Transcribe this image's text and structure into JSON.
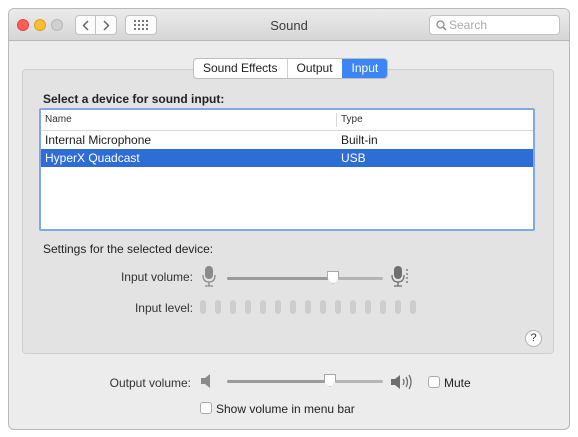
{
  "window": {
    "title": "Sound"
  },
  "search": {
    "placeholder": "Search"
  },
  "tabs": [
    {
      "label": "Sound Effects",
      "active": false
    },
    {
      "label": "Output",
      "active": false
    },
    {
      "label": "Input",
      "active": true
    }
  ],
  "input_section": {
    "heading": "Select a device for sound input:",
    "columns": {
      "name": "Name",
      "type": "Type"
    },
    "devices": [
      {
        "name": "Internal Microphone",
        "type": "Built-in",
        "selected": false
      },
      {
        "name": "HyperX Quadcast",
        "type": "USB",
        "selected": true
      }
    ]
  },
  "settings": {
    "label": "Settings for the selected device:",
    "input_volume_label": "Input volume:",
    "input_volume_value": 0.68,
    "input_level_label": "Input level:",
    "input_level_segments": 15,
    "input_level_active": 0
  },
  "output": {
    "volume_label": "Output volume:",
    "volume_value": 0.66,
    "mute_label": "Mute",
    "mute_checked": false,
    "show_in_menu_bar_label": "Show volume in menu bar",
    "show_in_menu_bar_checked": false
  },
  "help_label": "?",
  "colors": {
    "accent": "#3b86f4",
    "selection": "#2f6dd6"
  },
  "icons": [
    "back-arrow-icon",
    "forward-arrow-icon",
    "grid-icon",
    "search-icon",
    "microphone-icon",
    "speaker-icon",
    "help-icon"
  ]
}
